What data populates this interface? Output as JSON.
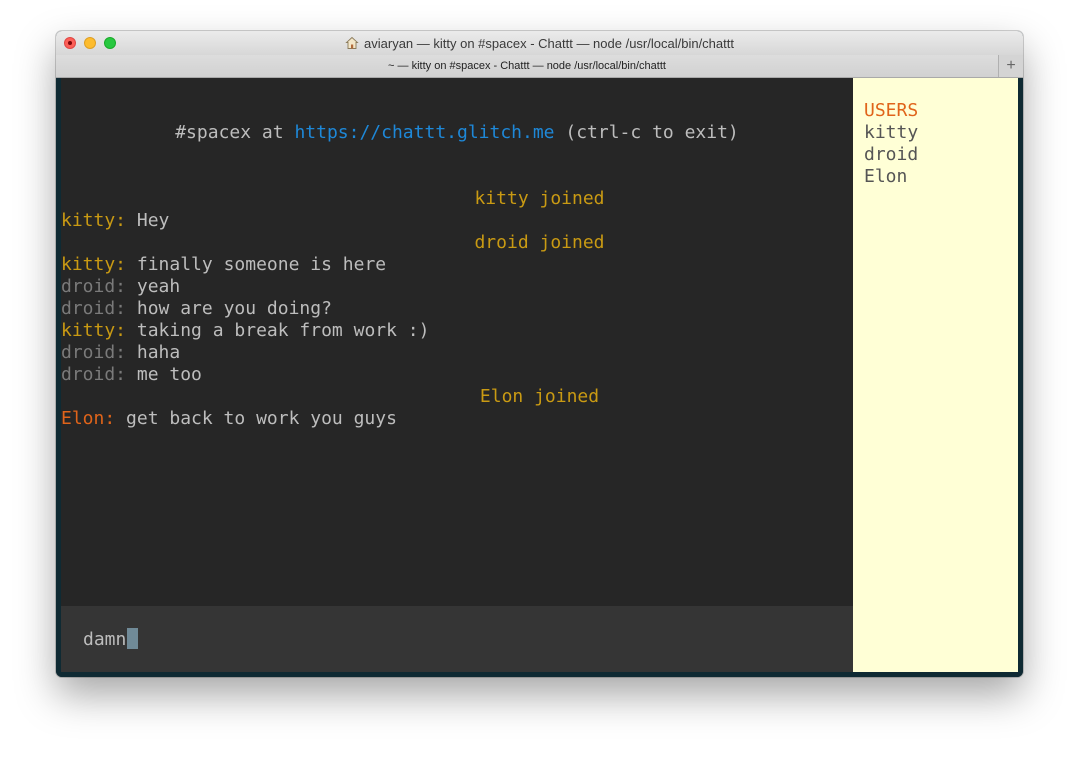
{
  "window": {
    "title": "aviaryan — kitty on #spacex - Chattt — node /usr/local/bin/chattt",
    "tab_label": "~ — kitty on #spacex - Chattt — node /usr/local/bin/chattt",
    "new_tab_label": "+"
  },
  "header": {
    "prefix": "#spacex at ",
    "url": "https://chattt.glitch.me",
    "suffix": " (ctrl-c to exit)"
  },
  "messages": [
    {
      "type": "join",
      "text": "kitty joined"
    },
    {
      "type": "msg",
      "user": "kitty:",
      "text": " Hey"
    },
    {
      "type": "join",
      "text": "droid joined"
    },
    {
      "type": "msg",
      "user": "kitty:",
      "text": " finally someone is here"
    },
    {
      "type": "msg",
      "user": "droid:",
      "text": " yeah"
    },
    {
      "type": "msg",
      "user": "droid:",
      "text": " how are you doing?"
    },
    {
      "type": "msg",
      "user": "kitty:",
      "text": " taking a break from work :)"
    },
    {
      "type": "msg",
      "user": "droid:",
      "text": " haha"
    },
    {
      "type": "msg",
      "user": "droid:",
      "text": " me too"
    },
    {
      "type": "join",
      "text": "Elon joined"
    },
    {
      "type": "msg",
      "user": "Elon:",
      "text": " get back to work you guys"
    }
  ],
  "input": {
    "value": "damn"
  },
  "sidebar": {
    "title": "USERS",
    "users": [
      "kitty",
      "droid",
      "Elon"
    ]
  },
  "colors": {
    "kitty": "#c99a13",
    "droid": "#7a7a7a",
    "Elon": "#e0641a",
    "join": "#c99a13",
    "url": "#1e88d8",
    "sidebar_bg": "#ffffd6",
    "chat_bg": "#262626"
  },
  "icons": {
    "title_icon": "home-icon"
  }
}
